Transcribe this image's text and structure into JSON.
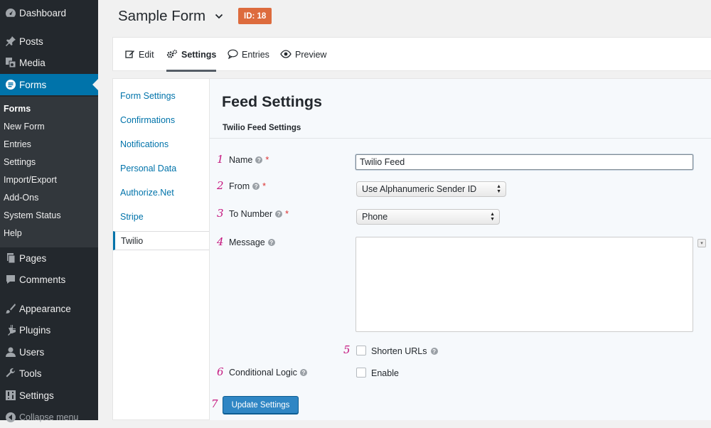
{
  "colors": {
    "sidebar_bg": "#23282d",
    "accent": "#0073aa",
    "badge": "#dd6b3d",
    "step_number": "#c5177f",
    "required": "#dc3232",
    "button": "#2f86c4"
  },
  "sidebar": {
    "top_items": [
      {
        "label": "Dashboard",
        "icon": "dashboard-icon"
      },
      {
        "label": "Posts",
        "icon": "pin-icon"
      },
      {
        "label": "Media",
        "icon": "media-icon"
      },
      {
        "label": "Forms",
        "icon": "forms-icon"
      }
    ],
    "submenu": [
      "Forms",
      "New Form",
      "Entries",
      "Settings",
      "Import/Export",
      "Add-Ons",
      "System Status",
      "Help"
    ],
    "bottom_items": [
      {
        "label": "Pages",
        "icon": "pages-icon"
      },
      {
        "label": "Comments",
        "icon": "comment-icon"
      },
      {
        "label": "Appearance",
        "icon": "paintbrush-icon"
      },
      {
        "label": "Plugins",
        "icon": "plugin-icon"
      },
      {
        "label": "Users",
        "icon": "user-icon"
      },
      {
        "label": "Tools",
        "icon": "wrench-icon"
      },
      {
        "label": "Settings",
        "icon": "settings-icon"
      }
    ],
    "collapse_label": "Collapse menu"
  },
  "header": {
    "form_title": "Sample Form",
    "id_badge": "ID: 18"
  },
  "toolbar": {
    "edit": "Edit",
    "settings": "Settings",
    "entries": "Entries",
    "preview": "Preview"
  },
  "settings_nav": [
    "Form Settings",
    "Confirmations",
    "Notifications",
    "Personal Data",
    "Authorize.Net",
    "Stripe",
    "Twilio"
  ],
  "feed": {
    "title": "Feed Settings",
    "subtitle": "Twilio Feed Settings",
    "fields": {
      "name": {
        "num": "1",
        "label": "Name",
        "value": "Twilio Feed"
      },
      "from": {
        "num": "2",
        "label": "From",
        "value": "Use Alphanumeric Sender ID"
      },
      "to": {
        "num": "3",
        "label": "To Number",
        "value": "Phone"
      },
      "message": {
        "num": "4",
        "label": "Message",
        "value": ""
      },
      "shorten": {
        "num": "5",
        "label": "Shorten URLs",
        "checked": false
      },
      "conditional": {
        "num": "6",
        "label": "Conditional Logic",
        "option": "Enable",
        "checked": false
      }
    },
    "step7": "7",
    "button": "Update Settings",
    "help_glyph": "?",
    "required_mark": "*"
  }
}
